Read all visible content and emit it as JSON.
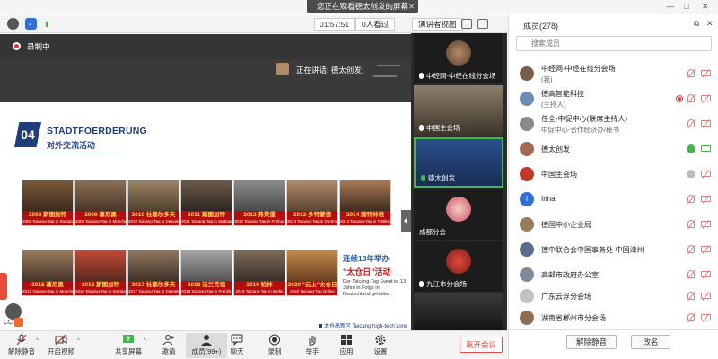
{
  "window": {
    "share_banner": "您正在观看德太创发的屏幕",
    "share_close": "✕"
  },
  "topbar": {
    "timer": "01:57:51",
    "viewers": "0人看过",
    "view_mode": "演讲者视图"
  },
  "slide": {
    "recording_label": "录制中",
    "speaking": "正在讲话: 德太创发;",
    "badge": "04",
    "title": "STADTFOERDERUNG",
    "subtitle": "对外交流活动",
    "row1": [
      {
        "label": "2008 斯图加特",
        "caption": "2008 Taicang-Tag in Stuttgart"
      },
      {
        "label": "2009 慕尼黑",
        "caption": "2009 Taicang-Tag in München"
      },
      {
        "label": "2010 杜塞尔多夫",
        "caption": "2010 Taicang-Tag in Düsseldorf"
      },
      {
        "label": "2011 斯图加特",
        "caption": "2011 Taicang-Tag in Stuttgart"
      },
      {
        "label": "2012 弗莱堡",
        "caption": "2012 Taicang-Tag in Freiburg"
      },
      {
        "label": "2013 多特蒙德",
        "caption": "2013 Taicang-Tag in Dortmund"
      },
      {
        "label": "2014 图特林根",
        "caption": "2014 Taicang-Tag in Tuttlingen"
      }
    ],
    "row2": [
      {
        "label": "2015 慕尼黑",
        "caption": "2015 Taicang-Tag in München"
      },
      {
        "label": "2016 斯图加特",
        "caption": "2016 Taicang-Tag in Stuttgart"
      },
      {
        "label": "2017 杜塞尔多夫",
        "caption": "2017 Taicang-Tag in Düsseldorf"
      },
      {
        "label": "2018 法兰克福",
        "caption": "2018 Taicang-Tag in Frankfurt"
      },
      {
        "label": "2019 柏林",
        "caption": "2019 Taicang-Tag in Berlin"
      },
      {
        "label": "2020 \"云上\"太仓日",
        "caption": "2020 Taicang-Tag Online"
      }
    ],
    "promo_line1": "连续13年举办",
    "promo_line2": "\"太仓日\"活动",
    "promo_line3": "Der Taicang-Tag Event ist 13 Jahre in Folge in Deutschland gehalten.",
    "footer_note": "太仓高新区 Taicang high-tech zone",
    "cc_label": "CC"
  },
  "strip": {
    "tiles": [
      {
        "label": "中经网-中经在线分会场"
      },
      {
        "label": "中国主会场"
      },
      {
        "label": "德太创发"
      },
      {
        "label": "成都分会"
      },
      {
        "label": "九江市分会场"
      },
      {
        "label": ""
      }
    ]
  },
  "toolbar": {
    "mute": "解除静音",
    "video": "开启视频",
    "share": "共享屏幕",
    "invite": "邀请",
    "members": "成员(99+)",
    "chat": "聊天",
    "record": "录制",
    "raise": "举手",
    "apps": "应用",
    "settings": "设置",
    "leave": "离开会议"
  },
  "panel": {
    "title": "成员(278)",
    "search_placeholder": "搜索成员",
    "members": [
      {
        "name": "中经网-中经在线分会场",
        "sub": "(我)",
        "avatar_color": "#7a5c48",
        "mic": "off",
        "cam": "off"
      },
      {
        "name": "德高智能科技",
        "sub": "(主持人)",
        "avatar_color": "#6b8fb3",
        "mic": "off",
        "cam": "off",
        "rec": true
      },
      {
        "name": "任全-中促中心(联席主持人)",
        "sub": "中促中心-合作经济办/秘书",
        "avatar_color": "#8a8a8a",
        "mic": "off",
        "cam": "off"
      },
      {
        "name": "德太创发",
        "sub": "",
        "avatar_color": "#a06b4f",
        "mic": "on",
        "cam": "on"
      },
      {
        "name": "中国主会场",
        "sub": "",
        "avatar_color": "#c0392b",
        "mic": "idle",
        "cam": "off"
      },
      {
        "name": "Irina",
        "sub": "",
        "avatar_color": "#2f6fd6",
        "mic": "off",
        "cam": "off",
        "initial": "I"
      },
      {
        "name": "德国中小企业局",
        "sub": "",
        "avatar_color": "#9b7b5e",
        "mic": "off",
        "cam": "off"
      },
      {
        "name": "德中联合会中国事务处-中国漳州",
        "sub": "",
        "avatar_color": "#5a6e8c",
        "mic": "off",
        "cam": "off"
      },
      {
        "name": "高邮市政府办公室",
        "sub": "",
        "avatar_color": "#7d8a99",
        "mic": "off",
        "cam": "off"
      },
      {
        "name": "广东云浮分会场",
        "sub": "",
        "avatar_color": "#c2c2c2",
        "mic": "off",
        "cam": "off"
      },
      {
        "name": "湖南省郴州市分会场",
        "sub": "",
        "avatar_color": "#8c6d55",
        "mic": "off",
        "cam": "off"
      }
    ],
    "unmute_all": "解除静音",
    "rename": "改名"
  },
  "colors": {
    "accent_blue": "#1f3e7a",
    "record_red": "#d83a3a",
    "active_green": "#3fbb4a",
    "caption_red": "#b30d0d"
  }
}
